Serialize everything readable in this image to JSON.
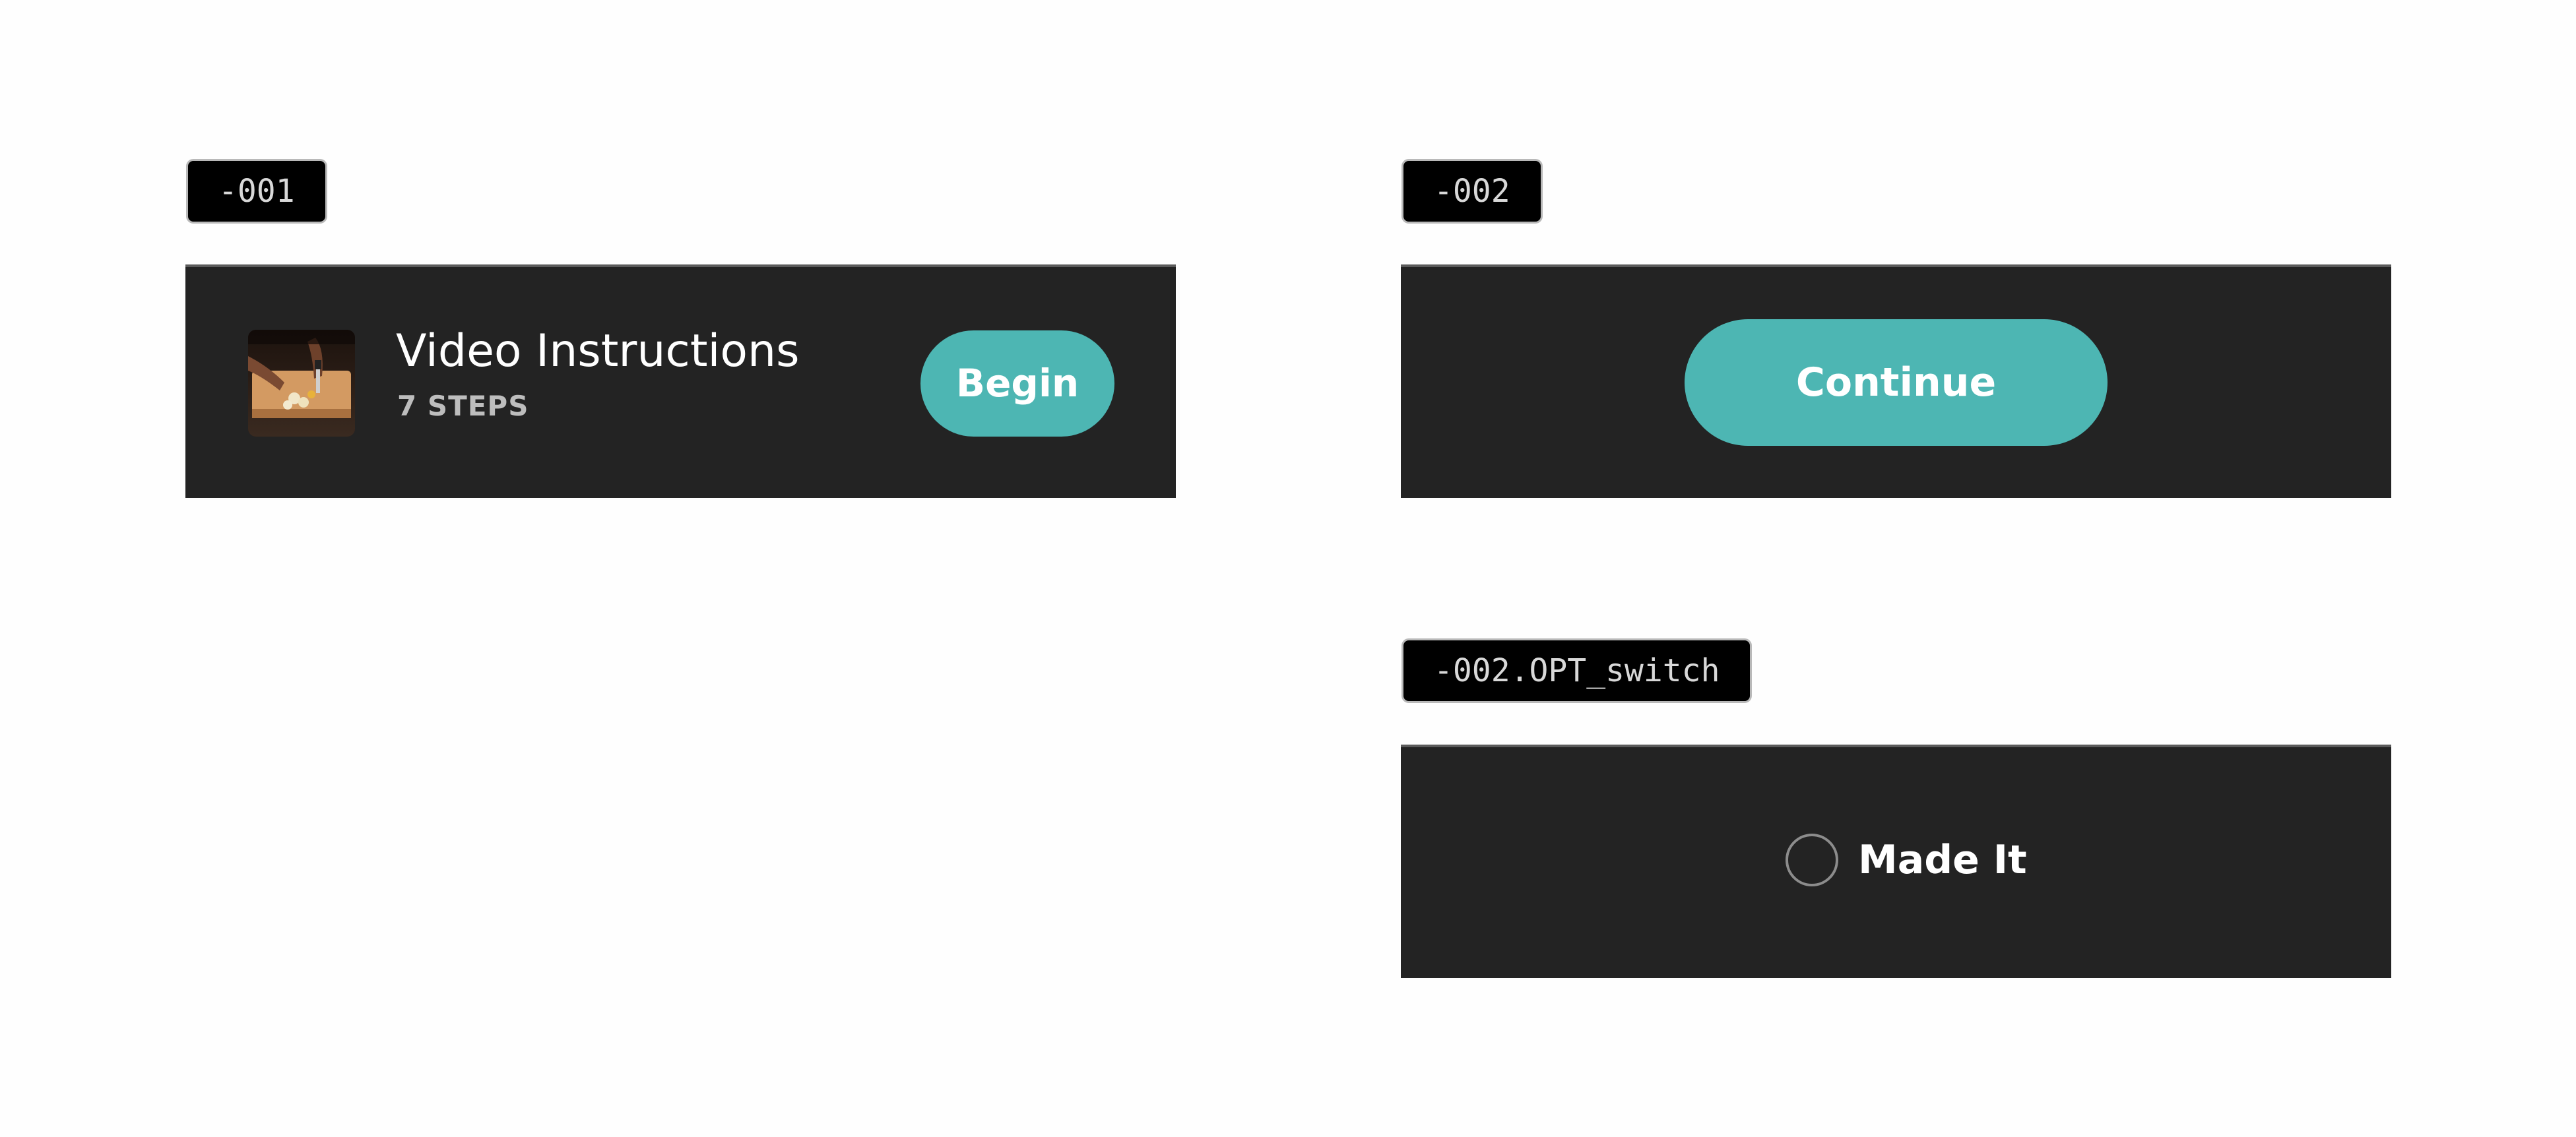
{
  "variant_001": {
    "tag": "-001",
    "thumbnail": "cutting-board-video-thumbnail",
    "title": "Video Instructions",
    "subtitle": "7 STEPS",
    "button_label": "Begin"
  },
  "variant_002": {
    "tag": "-002",
    "button_label": "Continue"
  },
  "variant_002_opt_switch": {
    "tag": "-002.OPT_switch",
    "radio_checked": false,
    "label": "Made It"
  },
  "colors": {
    "panel_background": "#232323",
    "accent_teal": "#4db6b3",
    "tag_background": "#000000"
  }
}
